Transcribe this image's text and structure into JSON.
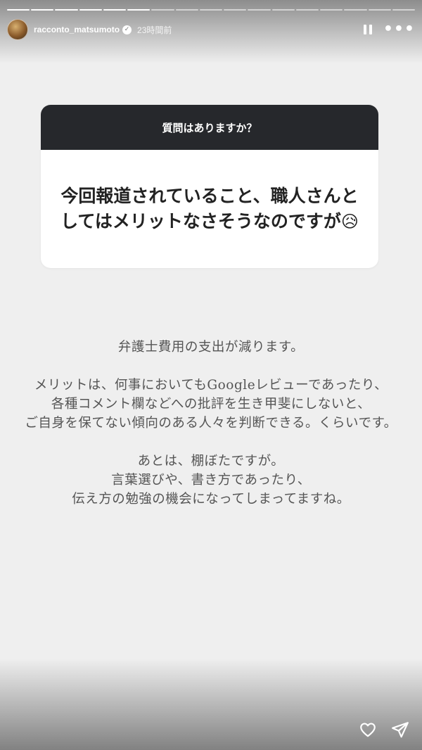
{
  "story": {
    "progress_total": 17,
    "progress_current": 6,
    "username": "racconto_matsumoto",
    "verified_icon": "verified-check-icon",
    "timestamp": "23時間前"
  },
  "question_box": {
    "title": "質問はありますか？",
    "answer": "今回報道されていること、職人さんとしてはメリットなさそうなのですが",
    "emoji": "😥"
  },
  "reply": {
    "paragraphs": [
      [
        "弁護士費用の支出が減ります。"
      ],
      [
        "メリットは、何事においてもGoogleレビューであったり、",
        "各種コメント欄などへの批評を生き甲斐にしないと、",
        "ご自身を保てない傾向のある人々を判断できる。くらいです。"
      ],
      [
        "あとは、棚ぼたですが。",
        "言葉選びや、書き方であったり、",
        "伝え方の勉強の機会になってしまってますね。"
      ]
    ]
  },
  "actions": {
    "like_icon": "heart-icon",
    "share_icon": "send-icon"
  }
}
